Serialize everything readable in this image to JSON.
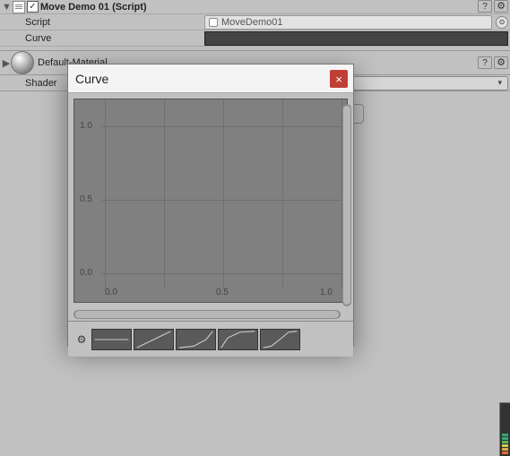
{
  "component": {
    "title": "Move Demo 01 (Script)",
    "scriptLabel": "Script",
    "scriptValue": "MoveDemo01",
    "curveLabel": "Curve"
  },
  "material": {
    "name": "Default-Material",
    "shaderLabel": "Shader"
  },
  "popup": {
    "title": "Curve",
    "closeGlyph": "×",
    "ylabels": [
      "1.0",
      "0.5",
      "0.0"
    ],
    "xlabels": [
      "0.0",
      "0.5",
      "1.0"
    ]
  },
  "presets": [
    "flat",
    "linear",
    "ease-in",
    "ease-out",
    "ease-in-out"
  ],
  "icons": {
    "foldout": "▼",
    "foldoutRight": "▶",
    "gear": "⚙",
    "help": "?",
    "dropArrow": "▾",
    "check": "✓",
    "picker": "⊙"
  },
  "chart_data": {
    "type": "line",
    "title": "Curve",
    "xlabel": "",
    "ylabel": "",
    "xlim": [
      0.0,
      1.0
    ],
    "ylim": [
      0.0,
      1.0
    ],
    "x_ticks": [
      0.0,
      0.5,
      1.0
    ],
    "y_ticks": [
      0.0,
      0.5,
      1.0
    ],
    "series": [],
    "grid": true,
    "legend": false
  }
}
